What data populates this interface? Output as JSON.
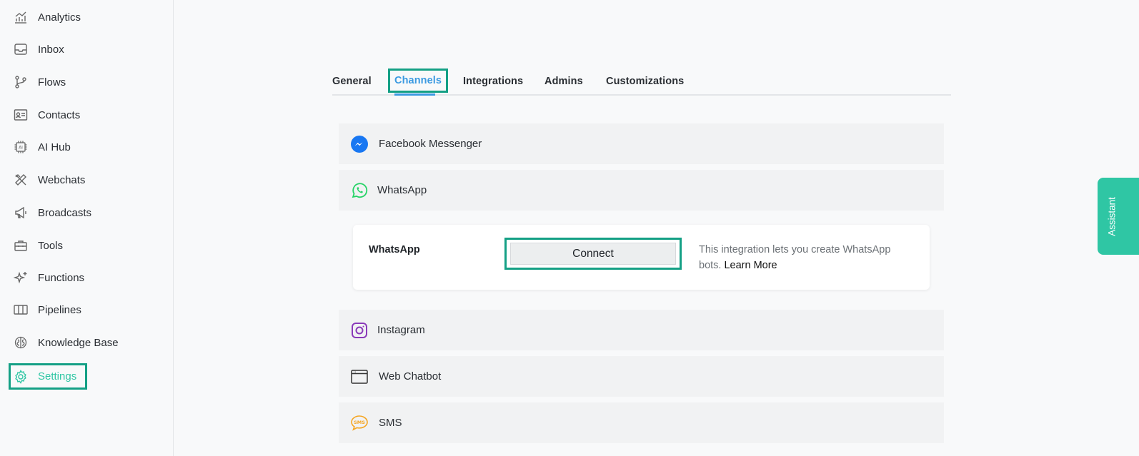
{
  "sidebar": {
    "items": [
      {
        "label": "Analytics",
        "icon": "analytics-icon"
      },
      {
        "label": "Inbox",
        "icon": "inbox-icon"
      },
      {
        "label": "Flows",
        "icon": "flows-icon"
      },
      {
        "label": "Contacts",
        "icon": "contacts-icon"
      },
      {
        "label": "AI Hub",
        "icon": "ai-chip-icon"
      },
      {
        "label": "Webchats",
        "icon": "tools-cross-icon"
      },
      {
        "label": "Broadcasts",
        "icon": "megaphone-icon"
      },
      {
        "label": "Tools",
        "icon": "toolbox-icon"
      },
      {
        "label": "Functions",
        "icon": "sparkle-plus-icon"
      },
      {
        "label": "Pipelines",
        "icon": "pipelines-columns-icon"
      },
      {
        "label": "Knowledge Base",
        "icon": "brain-icon"
      },
      {
        "label": "Settings",
        "icon": "gear-icon",
        "active": true
      }
    ]
  },
  "tabs": [
    {
      "label": "General"
    },
    {
      "label": "Channels",
      "active": true
    },
    {
      "label": "Integrations"
    },
    {
      "label": "Admins"
    },
    {
      "label": "Customizations"
    }
  ],
  "channels": [
    {
      "label": "Facebook Messenger",
      "icon": "messenger-icon"
    },
    {
      "label": "WhatsApp",
      "icon": "whatsapp-icon"
    },
    {
      "label": "Instagram",
      "icon": "instagram-icon"
    },
    {
      "label": "Web Chatbot",
      "icon": "browser-window-icon"
    },
    {
      "label": "SMS",
      "icon": "sms-bubble-icon"
    }
  ],
  "whatsapp_card": {
    "title": "WhatsApp",
    "connect_label": "Connect",
    "description": "This integration lets you create WhatsApp bots.",
    "learn_more": "Learn More"
  },
  "assistant_label": "Assistant",
  "colors": {
    "accent": "#2fc6a4",
    "highlight_border": "#14a085",
    "tab_active": "#3b9ae1"
  }
}
